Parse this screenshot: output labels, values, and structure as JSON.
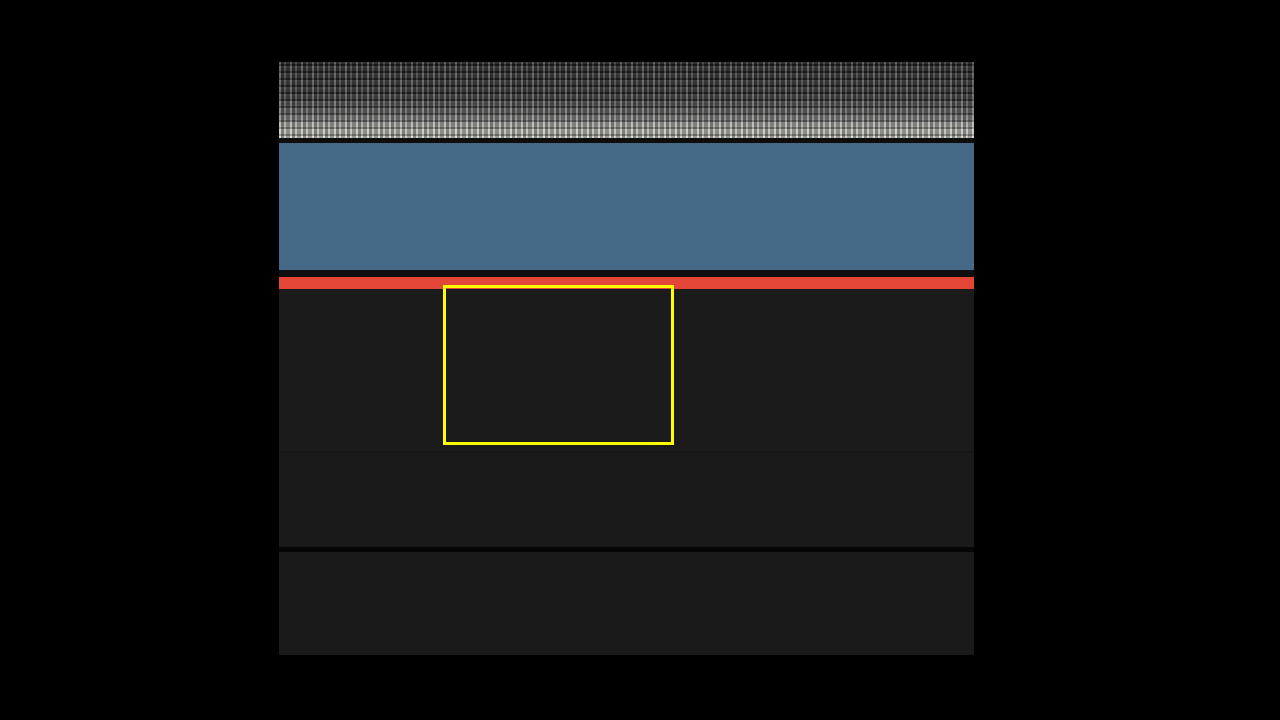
{
  "screen": {
    "background": "#000000"
  },
  "timeline": {
    "thumbnail_strip": {
      "icon": "video-thumbnail-strip"
    },
    "clip": {
      "color": "#456987"
    },
    "playhead_bar": {
      "color": "#e34536"
    },
    "interpolation_buttons": [
      {
        "name": "ease-interpolation",
        "icon": "ease-curve-icon"
      },
      {
        "name": "linear-interpolation",
        "icon": "linear-line-icon"
      }
    ]
  },
  "highlight": {
    "color": "#ffff00",
    "target": "ease-interpolation"
  }
}
